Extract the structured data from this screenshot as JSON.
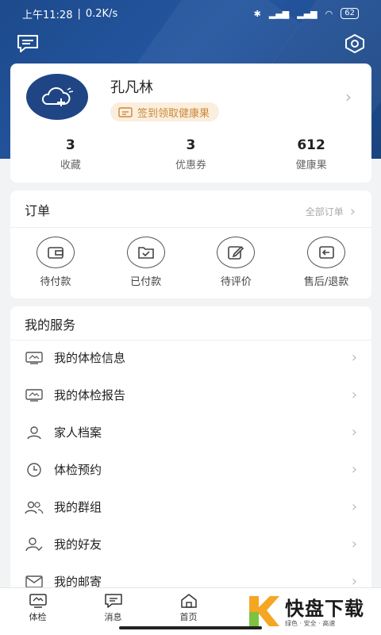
{
  "status_bar": {
    "time": "上午11:28",
    "speed": "0.2K/s",
    "battery": "62"
  },
  "profile": {
    "name": "孔凡林",
    "signin_label": "签到领取健康果",
    "stats": [
      {
        "value": "3",
        "label": "收藏"
      },
      {
        "value": "3",
        "label": "优惠券"
      },
      {
        "value": "612",
        "label": "健康果"
      }
    ]
  },
  "orders": {
    "title": "订单",
    "all_label": "全部订单",
    "items": [
      {
        "label": "待付款",
        "icon": "wallet-icon"
      },
      {
        "label": "已付款",
        "icon": "paid-folder-icon"
      },
      {
        "label": "待评价",
        "icon": "edit-icon"
      },
      {
        "label": "售后/退款",
        "icon": "refund-icon"
      }
    ]
  },
  "services": {
    "title": "我的服务",
    "items": [
      {
        "label": "我的体检信息",
        "icon": "monitor-icon"
      },
      {
        "label": "我的体检报告",
        "icon": "monitor-icon"
      },
      {
        "label": "家人档案",
        "icon": "person-icon"
      },
      {
        "label": "体检预约",
        "icon": "clock-icon"
      },
      {
        "label": "我的群组",
        "icon": "group-icon"
      },
      {
        "label": "我的好友",
        "icon": "friend-icon"
      },
      {
        "label": "我的邮寄",
        "icon": "mail-icon"
      }
    ]
  },
  "tabbar": {
    "tabs": [
      {
        "label": "体检",
        "icon": "checkup-icon"
      },
      {
        "label": "消息",
        "icon": "message-icon"
      },
      {
        "label": "首页",
        "icon": "home-icon"
      }
    ]
  },
  "watermark": {
    "main": "快盘下载",
    "sub": "绿色 · 安全 · 高速"
  },
  "colors": {
    "header": "#1f4a8f",
    "accent_badge": "#c98a3a",
    "badge_bg": "#fbeedd"
  }
}
